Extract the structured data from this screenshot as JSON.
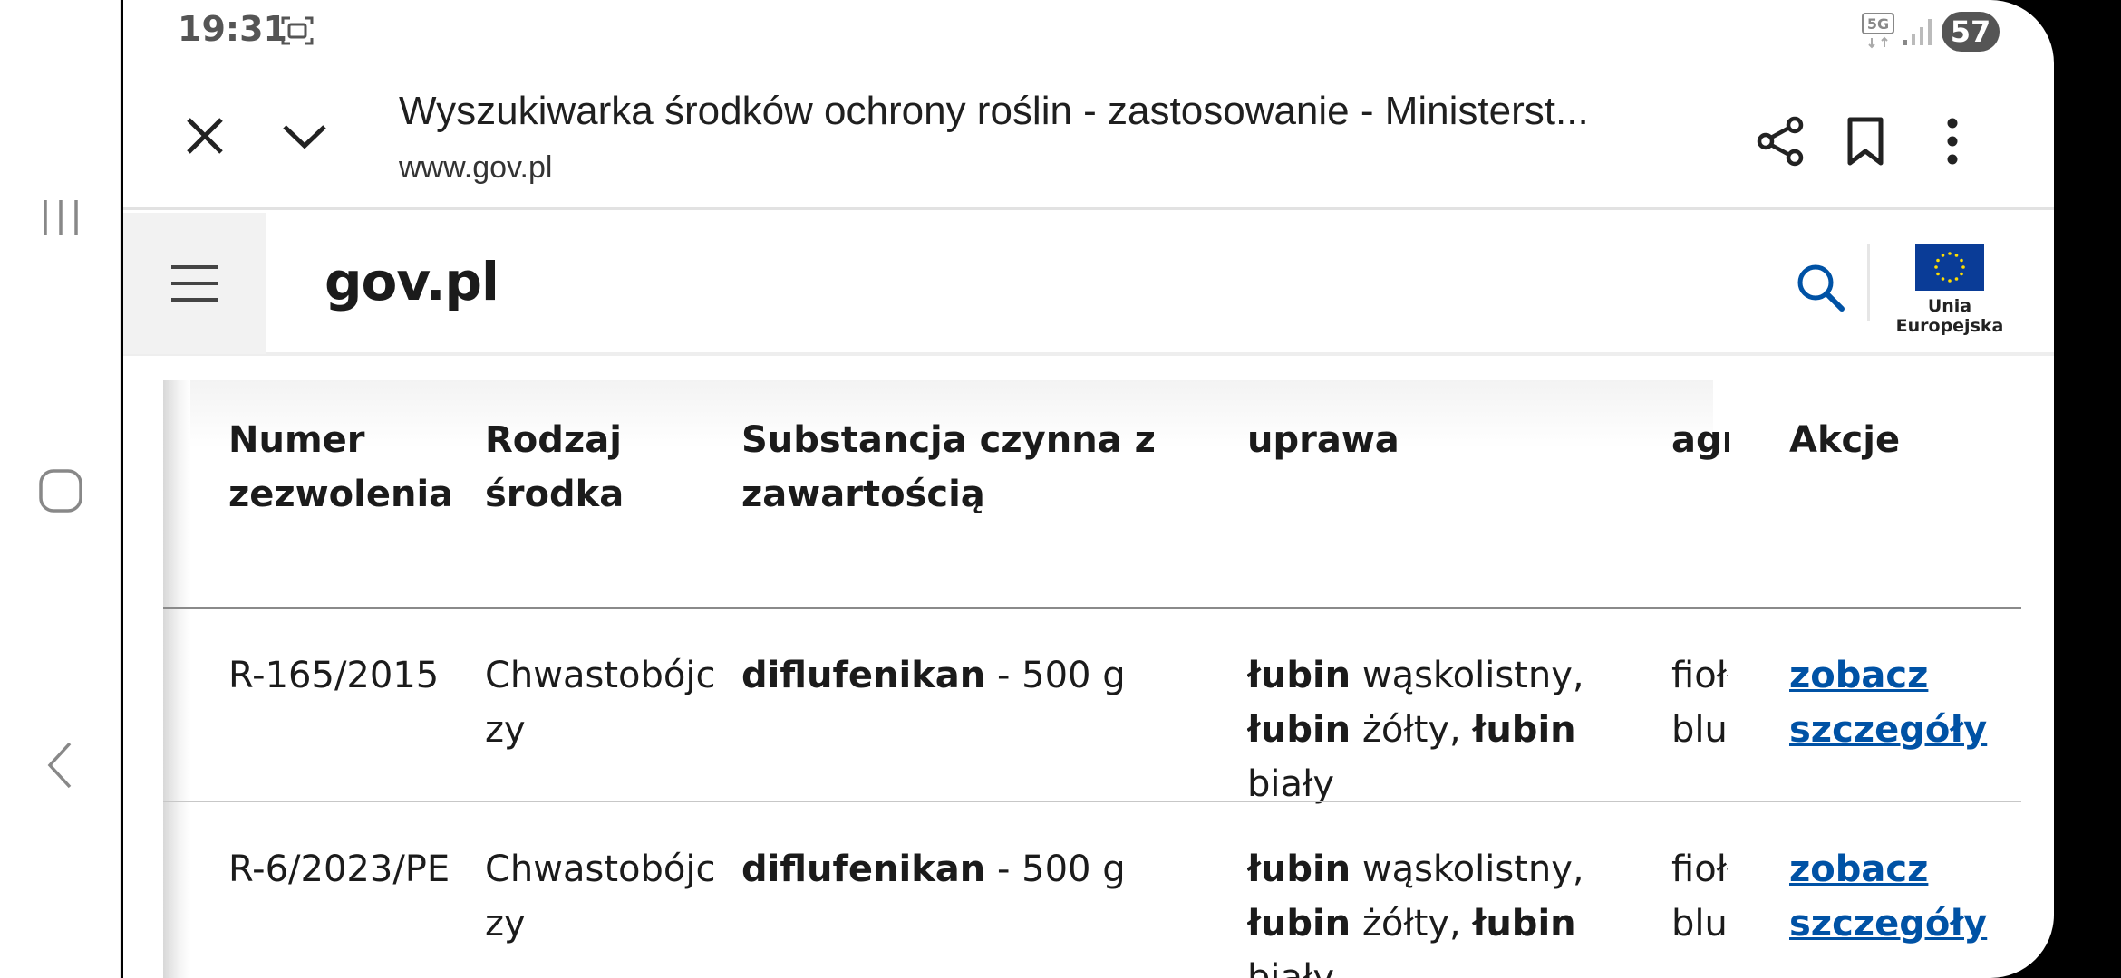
{
  "status": {
    "time": "19:31",
    "network": "5G",
    "battery": "57"
  },
  "tab": {
    "title": "Wyszukiwarka środków ochrony roślin - zastosowanie - Ministerst...",
    "url": "www.gov.pl"
  },
  "site": {
    "logo": "gov.pl",
    "eu_label": "Unia Europejska"
  },
  "table": {
    "headers": {
      "number_l1": "Numer",
      "number_l2": "zezwolenia",
      "type_l1": "Rodzaj",
      "type_l2": "środka",
      "substance_l1": "Substancja czynna z",
      "substance_l2": "zawartością",
      "crop": "uprawa",
      "agr": "agr",
      "actions": "Akcje"
    },
    "rows": [
      {
        "number": "R-165/2015",
        "type_l1": "Chwastobójc",
        "type_l2": "zy",
        "substance_name": "diflufenikan",
        "substance_amount": " - 500 g",
        "crop_b1": "łubin",
        "crop_t1": " wąskolistny,",
        "crop_b2": "łubin",
        "crop_t2": " żółty, ",
        "crop_b3": "łubin",
        "crop_t3": " biały",
        "agr_l1": "fiołł",
        "agr_l2": "blus",
        "action_l1": "zobacz",
        "action_l2": "szczegóły"
      },
      {
        "number": "R-6/2023/PE",
        "type_l1": "Chwastobójc",
        "type_l2": "zy",
        "substance_name": "diflufenikan",
        "substance_amount": " - 500 g",
        "crop_b1": "łubin",
        "crop_t1": " wąskolistny,",
        "crop_b2": "łubin",
        "crop_t2": " żółty, ",
        "crop_b3": "łubin",
        "crop_t3": " biały",
        "agr_l1": "fiołł",
        "agr_l2": "blus",
        "action_l1": "zobacz",
        "action_l2": "szczegóły"
      }
    ]
  }
}
